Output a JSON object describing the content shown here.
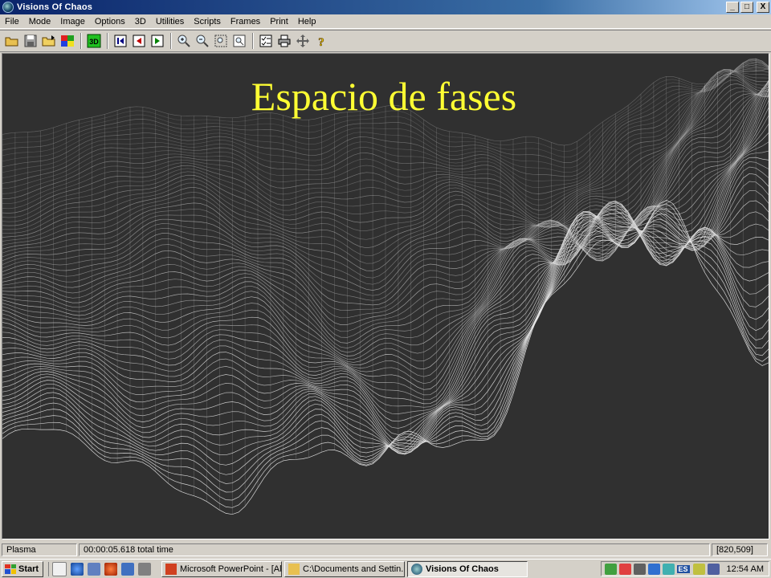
{
  "window": {
    "title": "Visions Of Chaos",
    "buttons": [
      "_",
      "□",
      "X"
    ]
  },
  "menu": [
    "File",
    "Mode",
    "Image",
    "Options",
    "3D",
    "Utilities",
    "Scripts",
    "Frames",
    "Print",
    "Help"
  ],
  "toolbar": {
    "icons": [
      "open-folder-icon",
      "save-icon",
      "open-icon",
      "palette-icon",
      "3d-icon",
      "first-frame-icon",
      "previous-frame-icon",
      "next-frame-icon",
      "zoom-in-icon",
      "zoom-out-icon",
      "zoom-box-icon",
      "zoom-reset-icon",
      "settings-checklist-icon",
      "print-icon",
      "move-icon",
      "help-icon"
    ],
    "label_3d": "3D"
  },
  "overlay": {
    "title": "Espacio de fases"
  },
  "status": {
    "mode": "Plasma",
    "time": "00:00:05.618 total time",
    "coords": "[820,509]"
  },
  "taskbar": {
    "start": "Start",
    "tasks": [
      {
        "label": "Microsoft PowerPoint - [Al...",
        "icon": "powerpoint-icon",
        "active": false
      },
      {
        "label": "C:\\Documents and Settin...",
        "icon": "folder-icon",
        "active": false
      },
      {
        "label": "Visions Of Chaos",
        "icon": "visions-of-chaos-icon",
        "active": true
      }
    ],
    "language": "ES",
    "clock": "12:54 AM"
  },
  "colors": {
    "title_gradient_start": "#0a246a",
    "title_gradient_end": "#a6caf0",
    "overlay_text": "#ffff33",
    "canvas_bg": "#303030"
  }
}
